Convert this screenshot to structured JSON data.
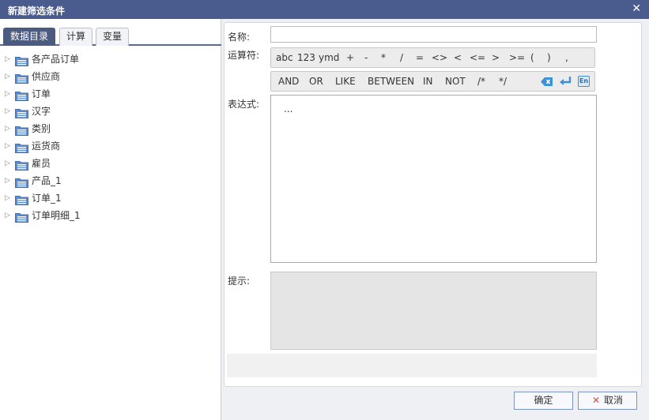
{
  "window": {
    "title": "新建筛选条件",
    "close_glyph": "✕"
  },
  "left": {
    "tabs": [
      {
        "label": "数据目录",
        "active": true
      },
      {
        "label": "计算",
        "active": false
      },
      {
        "label": "变量",
        "active": false
      }
    ],
    "tree": [
      {
        "label": "各产品订单"
      },
      {
        "label": "供应商"
      },
      {
        "label": "订单"
      },
      {
        "label": "汉字"
      },
      {
        "label": "类别"
      },
      {
        "label": "运货商"
      },
      {
        "label": "雇员"
      },
      {
        "label": "产品_1"
      },
      {
        "label": "订单_1"
      },
      {
        "label": "订单明细_1"
      }
    ]
  },
  "form": {
    "name_label": "名称:",
    "name_value": "",
    "ops_label": "运算符:",
    "ops_row1": [
      "abc",
      "123",
      "ymd",
      "+",
      "-",
      "*",
      "/",
      "=",
      "<>",
      "<",
      "<=",
      ">",
      ">=",
      "(",
      ")",
      ","
    ],
    "ops_row2": [
      "AND",
      "OR",
      "LIKE",
      "BETWEEN",
      "IN",
      "NOT",
      "/*",
      "*/"
    ],
    "tool_icons": {
      "clear": "backspace-icon",
      "newline": "enter-icon",
      "lang": "En"
    },
    "expr_label": "表达式:",
    "expr_value": "...",
    "hint_label": "提示:"
  },
  "buttons": {
    "ok": "确定",
    "cancel": "取消",
    "cancel_icon": "✕"
  },
  "colors": {
    "titlebar": "#4a5b8e",
    "tab_active": "#4b5a80",
    "icon_blue": "#3d8fd6",
    "cancel_x": "#e04a3b"
  }
}
